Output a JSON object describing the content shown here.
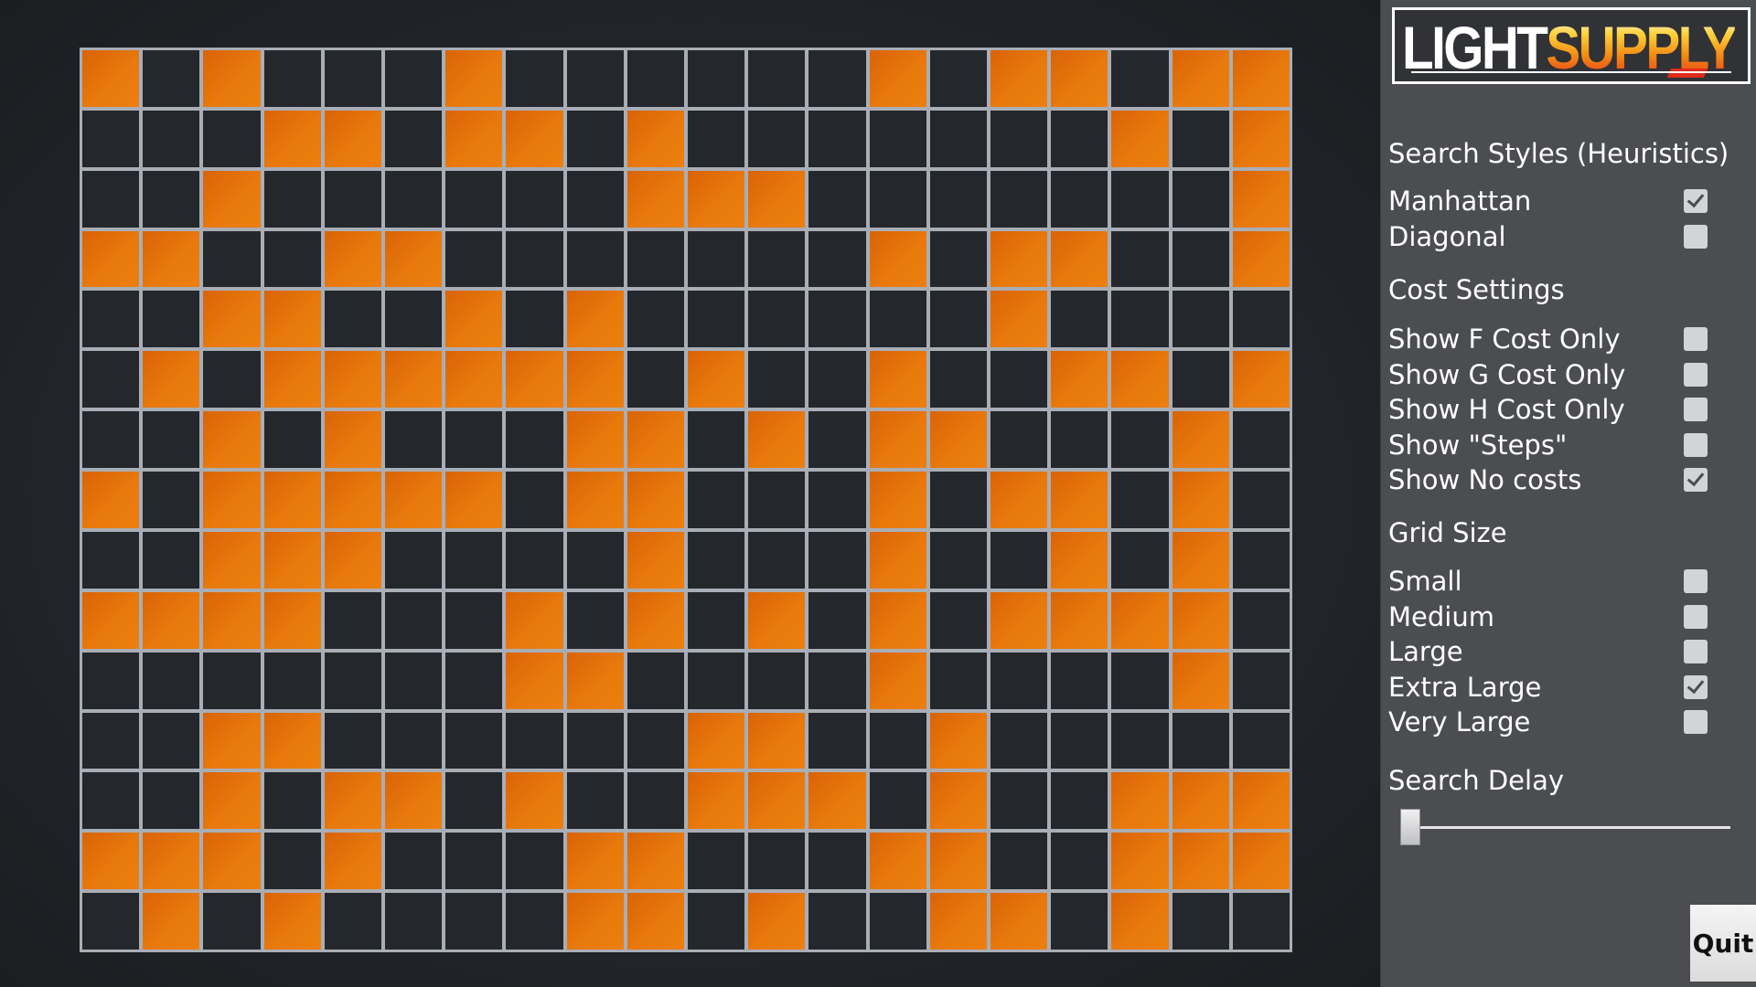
{
  "logo": {
    "text_light": "LIGHT",
    "text_supply": "SUPPLY"
  },
  "panel": {
    "heuristics": {
      "title": "Search Styles (Heuristics)",
      "options": [
        {
          "label": "Manhattan",
          "checked": true
        },
        {
          "label": "Diagonal",
          "checked": false
        }
      ]
    },
    "cost_settings": {
      "title": "Cost Settings",
      "options": [
        {
          "label": "Show F Cost Only",
          "checked": false
        },
        {
          "label": "Show G Cost Only",
          "checked": false
        },
        {
          "label": "Show H Cost Only",
          "checked": false
        },
        {
          "label": "Show \"Steps\"",
          "checked": false
        },
        {
          "label": "Show No costs",
          "checked": true
        }
      ]
    },
    "grid_size": {
      "title": "Grid Size",
      "options": [
        {
          "label": "Small",
          "checked": false
        },
        {
          "label": "Medium",
          "checked": false
        },
        {
          "label": "Large",
          "checked": false
        },
        {
          "label": "Extra Large",
          "checked": true
        },
        {
          "label": "Very Large",
          "checked": false
        }
      ]
    },
    "search_delay": {
      "title": "Search Delay",
      "value": 0.0
    },
    "quit_label": "Quit"
  },
  "grid": {
    "columns": 20,
    "rows": 15,
    "cell_colors": {
      "on": "#e8790c",
      "off": "#24272c",
      "line": "#a9aeb6"
    },
    "cells": [
      "10100010000001011011",
      "00011011010000000101",
      "00100000011100000001",
      "11001100000001011001",
      "00110010100000010000",
      "01011111101001001101",
      "00101000110101100010",
      "10111110110001011010",
      "00111000010001001010",
      "11110001010101011110",
      "00000001100001000010",
      "00110000001100100000",
      "00101101001110100111",
      "11101000110001100111",
      "01010000110100110100"
    ]
  },
  "colors": {
    "panel_bg": "#4b4d51",
    "accent_orange": "#e8790c",
    "text": "#ffffff"
  }
}
